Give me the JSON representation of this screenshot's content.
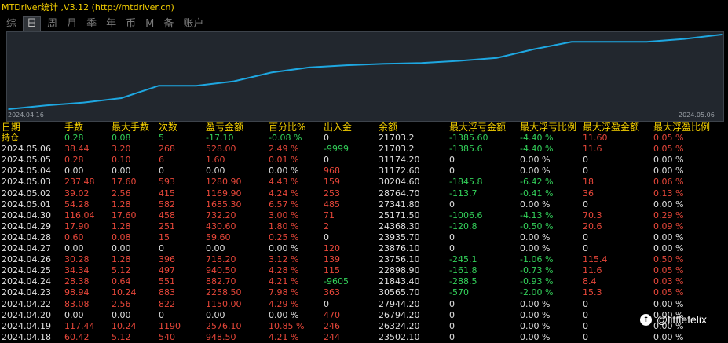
{
  "app": {
    "title": "MTDriver统计 ,V3.12 (http://mtdriver.cn)"
  },
  "tabs": [
    {
      "label": "综",
      "active": false
    },
    {
      "label": "日",
      "active": true
    },
    {
      "label": "周",
      "active": false
    },
    {
      "label": "月",
      "active": false
    },
    {
      "label": "季",
      "active": false
    },
    {
      "label": "年",
      "active": false
    },
    {
      "label": "币",
      "active": false
    },
    {
      "label": "M",
      "active": false
    },
    {
      "label": "备",
      "active": false
    },
    {
      "label": "账户",
      "active": false
    }
  ],
  "chart_data": {
    "type": "line",
    "start_date": "2024.04.16",
    "end_date": "2024.05.06",
    "x": [
      "2024.04.16",
      "2024.04.17",
      "2024.04.18",
      "2024.04.19",
      "2024.04.20",
      "2024.04.22",
      "2024.04.23",
      "2024.04.24",
      "2024.04.25",
      "2024.04.26",
      "2024.04.27",
      "2024.04.28",
      "2024.04.29",
      "2024.04.30",
      "2024.05.01",
      "2024.05.02",
      "2024.05.03",
      "2024.05.04",
      "2024.05.05",
      "2024.05.06"
    ],
    "values": [
      0,
      2.5,
      4.5,
      7.5,
      16,
      16,
      19,
      25,
      28.5,
      30,
      31,
      31.5,
      33,
      35,
      41,
      46,
      46,
      46,
      48,
      51
    ],
    "color": "#1ea7e1",
    "grid": false
  },
  "table": {
    "headers": [
      "日期",
      "手数",
      "最大手数",
      "次数",
      "盈亏金额",
      "百分比%",
      "出入金",
      "余额",
      "最大浮亏金额",
      "最大浮亏比例",
      "最大浮盈金额",
      "最大浮盈比例"
    ],
    "summary": {
      "label": "持仓",
      "lots": "0.28",
      "max_lots": "0.08",
      "count": "5",
      "pnl": "-17.10",
      "pct": "-0.08 %",
      "flow": "0",
      "balance": "21703.2",
      "max_float_loss": "-1385.60",
      "max_float_loss_pct": "-4.40 %",
      "max_float_profit": "11.60",
      "max_float_profit_pct": "0.05 %"
    },
    "rows": [
      [
        "2024.05.06",
        "38.44",
        "3.20",
        "268",
        "528.00",
        "2.49 %",
        "-9999",
        "21703.2",
        "-1385.6",
        "-4.40 %",
        "11.6",
        "0.05 %"
      ],
      [
        "2024.05.05",
        "0.28",
        "0.10",
        "6",
        "1.60",
        "0.01 %",
        "0",
        "31174.20",
        "0",
        "0.00 %",
        "0",
        "0.00 %"
      ],
      [
        "2024.05.04",
        "0.00",
        "0.00",
        "0",
        "0.00",
        "0.00 %",
        "968",
        "31172.60",
        "0",
        "0.00 %",
        "0",
        "0.00 %"
      ],
      [
        "2024.05.03",
        "237.48",
        "17.60",
        "593",
        "1280.90",
        "4.43 %",
        "159",
        "30204.60",
        "-1845.8",
        "-6.42 %",
        "18",
        "0.06 %"
      ],
      [
        "2024.05.02",
        "39.02",
        "2.56",
        "415",
        "1169.90",
        "4.24 %",
        "253",
        "28764.70",
        "-113.7",
        "-0.41 %",
        "36",
        "0.13 %"
      ],
      [
        "2024.05.01",
        "54.28",
        "1.28",
        "582",
        "1685.30",
        "6.57 %",
        "485",
        "27341.80",
        "0",
        "0.00 %",
        "0",
        "0.00 %"
      ],
      [
        "2024.04.30",
        "116.04",
        "17.60",
        "458",
        "732.20",
        "3.00 %",
        "71",
        "25171.50",
        "-1006.6",
        "-4.13 %",
        "70.3",
        "0.29 %"
      ],
      [
        "2024.04.29",
        "17.90",
        "1.28",
        "251",
        "430.60",
        "1.80 %",
        "2",
        "24368.30",
        "-120.8",
        "-0.50 %",
        "20.6",
        "0.09 %"
      ],
      [
        "2024.04.28",
        "0.60",
        "0.08",
        "15",
        "59.60",
        "0.25 %",
        "0",
        "23935.70",
        "0",
        "0.00 %",
        "0",
        "0.00 %"
      ],
      [
        "2024.04.27",
        "0.00",
        "0.00",
        "0",
        "0.00",
        "0.00 %",
        "120",
        "23876.10",
        "0",
        "0.00 %",
        "0",
        "0.00 %"
      ],
      [
        "2024.04.26",
        "30.28",
        "1.28",
        "396",
        "718.20",
        "3.12 %",
        "139",
        "23756.10",
        "-245.1",
        "-1.06 %",
        "115.4",
        "0.50 %"
      ],
      [
        "2024.04.25",
        "34.34",
        "5.12",
        "497",
        "940.50",
        "4.28 %",
        "115",
        "22898.90",
        "-161.8",
        "-0.73 %",
        "11.6",
        "0.05 %"
      ],
      [
        "2024.04.24",
        "28.38",
        "0.64",
        "551",
        "882.70",
        "4.21 %",
        "-9605",
        "21843.40",
        "-288.5",
        "-0.93 %",
        "8.4",
        "0.03 %"
      ],
      [
        "2024.04.23",
        "98.94",
        "10.24",
        "883",
        "2258.50",
        "7.98 %",
        "363",
        "30565.70",
        "-570",
        "-2.00 %",
        "15.3",
        "0.05 %"
      ],
      [
        "2024.04.22",
        "83.08",
        "2.56",
        "822",
        "1150.00",
        "4.29 %",
        "0",
        "27944.20",
        "0",
        "0.00 %",
        "0",
        "0.00 %"
      ],
      [
        "2024.04.20",
        "0.00",
        "0.00",
        "0",
        "0.00",
        "0.00 %",
        "470",
        "26794.20",
        "0",
        "0.00 %",
        "0",
        "0.00 %"
      ],
      [
        "2024.04.19",
        "117.44",
        "10.24",
        "1190",
        "2576.10",
        "10.85 %",
        "246",
        "26324.20",
        "0",
        "0.00 %",
        "0",
        "0.00 %"
      ],
      [
        "2024.04.18",
        "60.42",
        "5.12",
        "540",
        "948.50",
        "4.21 %",
        "244",
        "23502.10",
        "0",
        "0.00 %",
        "0",
        "0.00 %"
      ]
    ]
  },
  "watermark": {
    "icon": "facebook-icon",
    "text": "@littlefelix"
  }
}
